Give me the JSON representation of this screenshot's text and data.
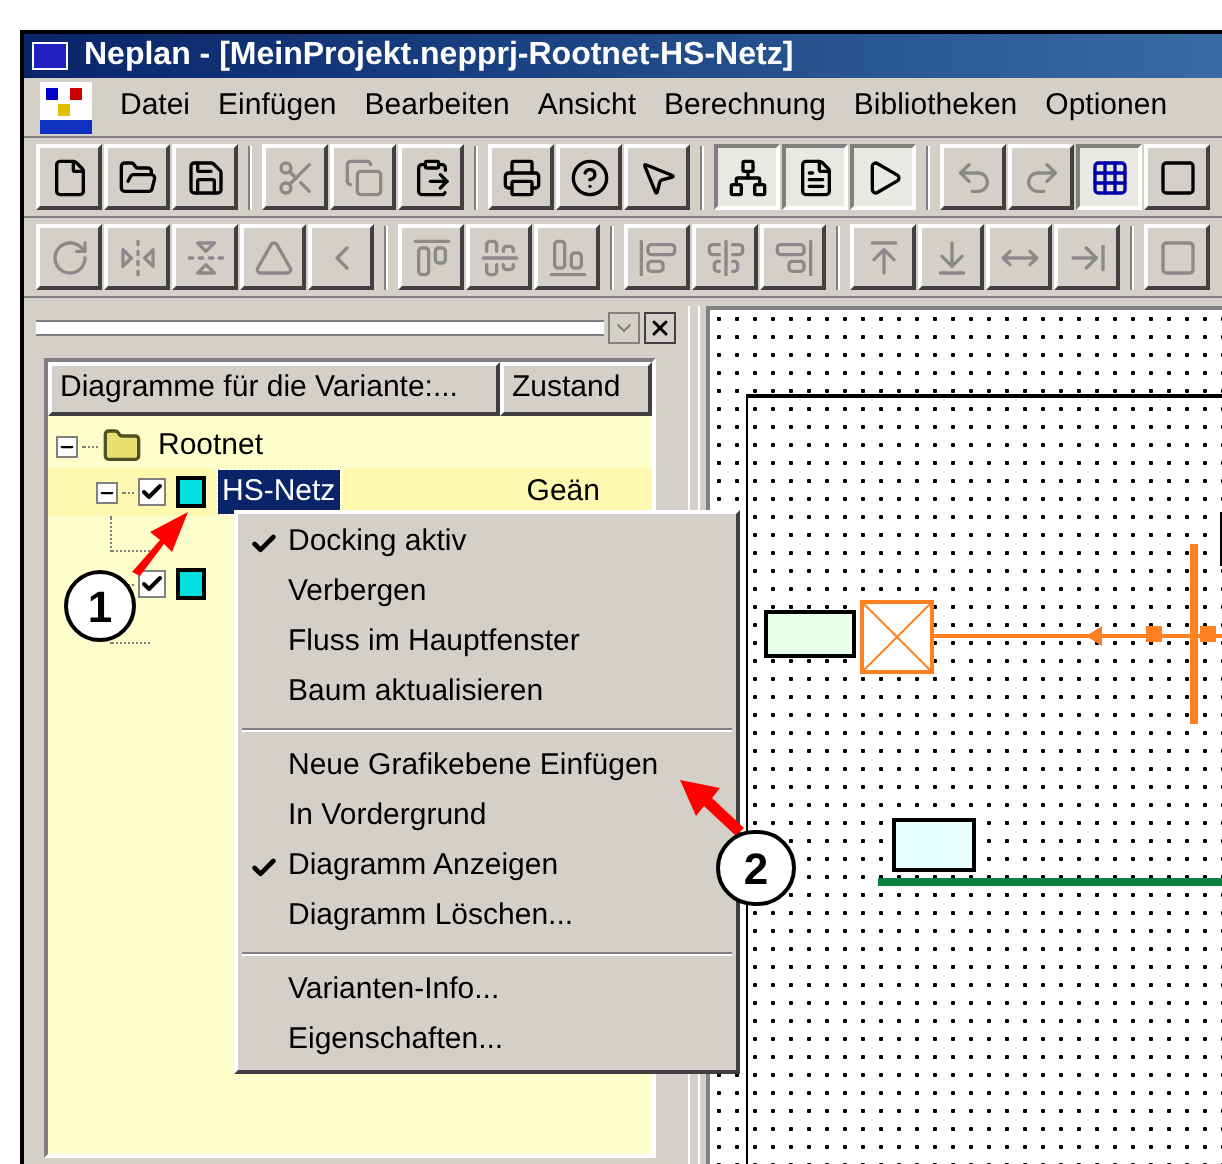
{
  "window": {
    "title": "Neplan - [MeinProjekt.nepprj-Rootnet-HS-Netz]"
  },
  "menu_bar": [
    "Datei",
    "Einfügen",
    "Bearbeiten",
    "Ansicht",
    "Berechnung",
    "Bibliotheken",
    "Optionen"
  ],
  "toolbar_1": [
    {
      "disabled": false,
      "pressed": false
    },
    {
      "disabled": false,
      "pressed": false
    },
    {
      "disabled": false,
      "pressed": false
    },
    {
      "disabled": true,
      "pressed": false
    },
    {
      "disabled": true,
      "pressed": false
    },
    {
      "disabled": false,
      "pressed": false
    },
    {
      "disabled": false,
      "pressed": false
    },
    {
      "disabled": false,
      "pressed": false
    },
    {
      "disabled": false,
      "pressed": false
    },
    {
      "disabled": false,
      "pressed": true
    },
    {
      "disabled": false,
      "pressed": true
    },
    {
      "disabled": false,
      "pressed": true
    },
    {
      "disabled": true,
      "pressed": false
    },
    {
      "disabled": true,
      "pressed": false
    },
    {
      "disabled": false,
      "pressed": true
    },
    {
      "disabled": false,
      "pressed": false
    }
  ],
  "toolbar_2": [
    {
      "disabled": true
    },
    {
      "disabled": true
    },
    {
      "disabled": true
    },
    {
      "disabled": true
    },
    {
      "disabled": true
    },
    {
      "disabled": true
    },
    {
      "disabled": true
    },
    {
      "disabled": true
    },
    {
      "disabled": true
    },
    {
      "disabled": true
    },
    {
      "disabled": true
    },
    {
      "disabled": true
    },
    {
      "disabled": true
    },
    {
      "disabled": true
    },
    {
      "disabled": true
    },
    {
      "disabled": true
    }
  ],
  "diagram_panel": {
    "columns": [
      "Diagramme für die Variante:...",
      "Zustand"
    ],
    "tree": [
      {
        "label": "Rootnet",
        "expanded": true,
        "children": [
          {
            "label": "HS-Netz",
            "status": "Geän",
            "checked": true,
            "selected": true,
            "expanded": true
          },
          {
            "checked": true,
            "selected": false
          }
        ]
      }
    ]
  },
  "context_menu": {
    "groups": [
      [
        {
          "label": "Docking aktiv",
          "checked": true
        },
        {
          "label": "Verbergen",
          "checked": false
        },
        {
          "label": "Fluss im Hauptfenster",
          "checked": false
        },
        {
          "label": "Baum aktualisieren",
          "checked": false
        }
      ],
      [
        {
          "label": "Neue Grafikebene Einfügen",
          "checked": false
        },
        {
          "label": "In Vordergrund",
          "checked": false
        },
        {
          "label": "Diagramm Anzeigen",
          "checked": true
        },
        {
          "label": "Diagramm Löschen...",
          "checked": false
        }
      ],
      [
        {
          "label": "Varianten-Info...",
          "checked": false
        },
        {
          "label": "Eigenschaften...",
          "checked": false
        }
      ]
    ]
  },
  "callouts": [
    "1",
    "2"
  ]
}
